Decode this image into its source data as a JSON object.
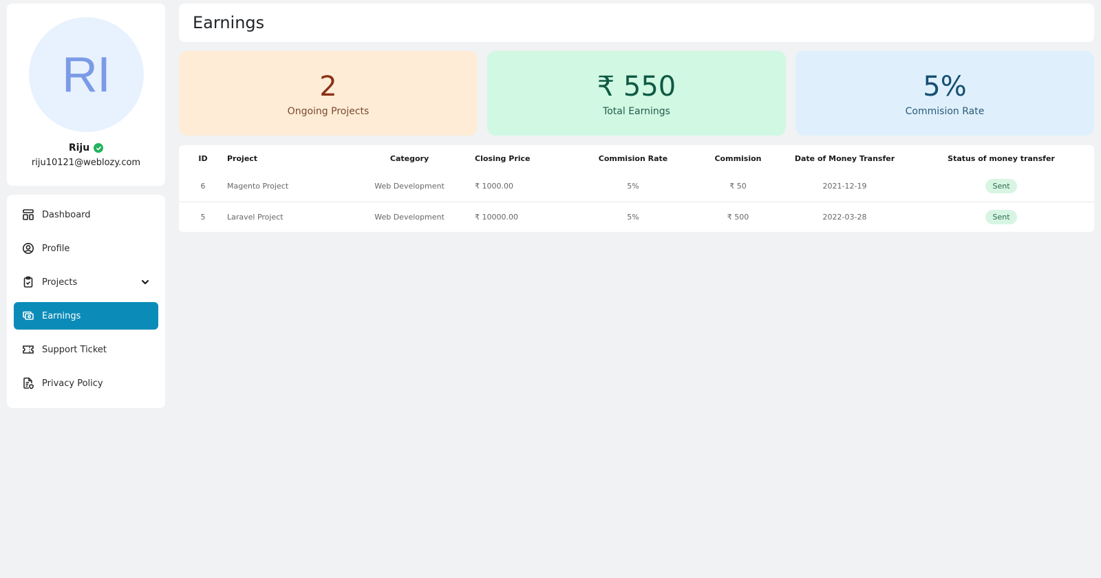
{
  "profile": {
    "initials": "RI",
    "name": "Riju",
    "email": "riju10121@weblozy.com",
    "verified": true
  },
  "sidebar": {
    "items": [
      {
        "label": "Dashboard",
        "icon": "dashboard-icon"
      },
      {
        "label": "Profile",
        "icon": "user-circle-icon"
      },
      {
        "label": "Projects",
        "icon": "clipboard-check-icon",
        "has_submenu": true
      },
      {
        "label": "Earnings",
        "icon": "cash-icon",
        "active": true
      },
      {
        "label": "Support Ticket",
        "icon": "ticket-icon"
      },
      {
        "label": "Privacy Policy",
        "icon": "file-shield-icon"
      }
    ]
  },
  "header": {
    "title": "Earnings"
  },
  "stats": [
    {
      "value": "2",
      "label": "Ongoing Projects",
      "bg": "#feecd6",
      "color": "#8a3216"
    },
    {
      "value": "₹ 550",
      "label": "Total Earnings",
      "bg": "#d1f8e3",
      "color": "#0f5a43"
    },
    {
      "value": "5%",
      "label": "Commision Rate",
      "bg": "#dff0fc",
      "color": "#174f72"
    }
  ],
  "table": {
    "columns": [
      "ID",
      "Project",
      "Category",
      "Closing Price",
      "Commision Rate",
      "Commision",
      "Date of Money Transfer",
      "Status of money transfer"
    ],
    "rows": [
      {
        "id": "6",
        "project": "Magento Project",
        "category": "Web Development",
        "closing_price": "₹ 1000.00",
        "commision_rate": "5%",
        "commision": "₹ 50",
        "date": "2021-12-19",
        "status": "Sent"
      },
      {
        "id": "5",
        "project": "Laravel Project",
        "category": "Web Development",
        "closing_price": "₹ 10000.00",
        "commision_rate": "5%",
        "commision": "₹ 500",
        "date": "2022-03-28",
        "status": "Sent"
      }
    ]
  },
  "colors": {
    "accent": "#0b8cb8",
    "verified": "#22b35e",
    "status_sent_bg": "#d8f5e4"
  }
}
